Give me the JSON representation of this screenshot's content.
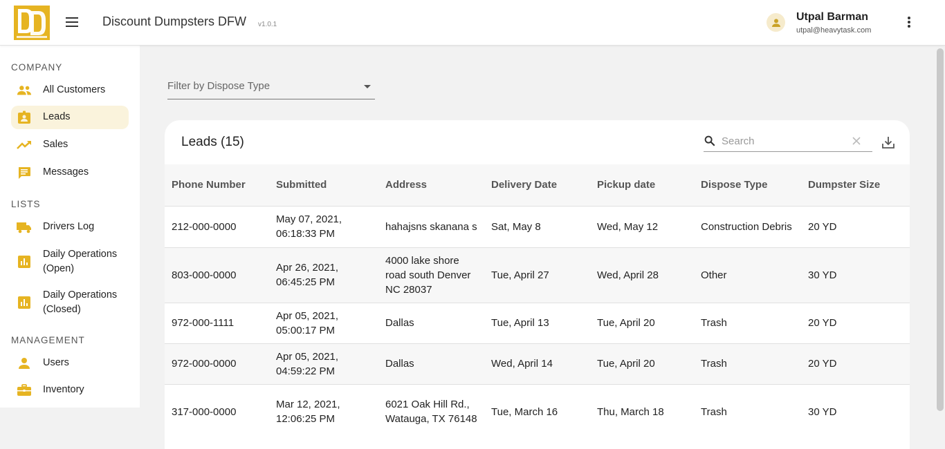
{
  "header": {
    "app_title": "Discount Dumpsters DFW",
    "version": "v1.0.1",
    "user_name": "Utpal Barman",
    "user_email": "utpal@heavytask.com",
    "menu_icon": "hamburger-menu-icon",
    "more_icon": "more-vertical-icon",
    "brand_color": "#e6b422"
  },
  "sidebar": {
    "sections": [
      {
        "label": "COMPANY",
        "items": [
          {
            "label": "All Customers",
            "icon": "people-icon",
            "active": false
          },
          {
            "label": "Leads",
            "icon": "contact-badge-icon",
            "active": true
          },
          {
            "label": "Sales",
            "icon": "trending-up-icon",
            "active": false
          },
          {
            "label": "Messages",
            "icon": "message-icon",
            "active": false
          }
        ]
      },
      {
        "label": "LISTS",
        "items": [
          {
            "label": "Drivers Log",
            "icon": "truck-icon",
            "active": false
          },
          {
            "label": "Daily Operations (Open)",
            "icon": "bar-chart-icon",
            "active": false
          },
          {
            "label": "Daily Operations (Closed)",
            "icon": "bar-chart-icon",
            "active": false
          }
        ]
      },
      {
        "label": "MANAGEMENT",
        "items": [
          {
            "label": "Users",
            "icon": "person-icon",
            "active": false
          },
          {
            "label": "Inventory",
            "icon": "briefcase-icon",
            "active": false
          }
        ]
      }
    ]
  },
  "filter": {
    "label": "Filter by Dispose Type",
    "value": ""
  },
  "leads": {
    "title": "Leads (15)",
    "search_placeholder": "Search",
    "columns": [
      "Phone Number",
      "Submitted",
      "Address",
      "Delivery Date",
      "Pickup date",
      "Dispose Type",
      "Dumpster Size"
    ],
    "rows": [
      [
        "212-000-0000",
        "May 07, 2021, 06:18:33 PM",
        "hahajsns skanana s",
        "Sat, May 8",
        "Wed, May 12",
        "Construction Debris",
        "20 YD"
      ],
      [
        "803-000-0000",
        "Apr 26, 2021, 06:45:25 PM",
        "4000 lake shore road south Denver NC 28037",
        "Tue, April 27",
        "Wed, April 28",
        "Other",
        "30 YD"
      ],
      [
        "972-000-1111",
        "Apr 05, 2021, 05:00:17 PM",
        "Dallas",
        "Tue, April 13",
        "Tue, April 20",
        "Trash",
        "20 YD"
      ],
      [
        "972-000-0000",
        "Apr 05, 2021, 04:59:22 PM",
        "Dallas",
        "Wed, April 14",
        "Tue, April 20",
        "Trash",
        "20 YD"
      ],
      [
        "317-000-0000",
        "Mar 12, 2021, 12:06:25 PM",
        "6021 Oak Hill Rd., Watauga, TX 76148",
        "Tue, March 16",
        "Thu, March 18",
        "Trash",
        "30 YD"
      ]
    ]
  }
}
